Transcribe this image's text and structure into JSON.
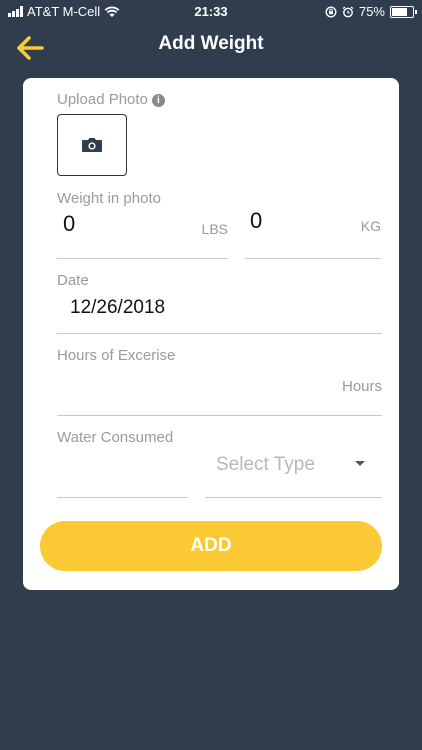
{
  "status_bar": {
    "carrier": "AT&T M-Cell",
    "time": "21:33",
    "battery": "75%",
    "battery_level": 0.75,
    "icons": [
      "signal-icon",
      "wifi-icon",
      "rotation-lock-icon",
      "alarm-icon",
      "battery-icon"
    ]
  },
  "header": {
    "title": "Add Weight",
    "back_icon": "back-arrow-icon"
  },
  "form": {
    "upload_photo_label": "Upload Photo",
    "info_icon_glyph": "i",
    "camera_icon": "camera-icon",
    "weight_label": "Weight in photo",
    "weight_lbs_value": "0",
    "weight_lbs_unit": "LBS",
    "weight_kg_value": "0",
    "weight_kg_unit": "KG",
    "date_label": "Date",
    "date_value": "12/26/2018",
    "hours_label": "Hours of Excerise",
    "hours_unit": "Hours",
    "water_label": "Water Consumed",
    "water_type_placeholder": "Select Type",
    "dropdown_icon": "caret-down-icon",
    "add_button": "ADD"
  },
  "colors": {
    "background": "#2f3d4e",
    "accent": "#fbc934",
    "card": "#ffffff"
  }
}
